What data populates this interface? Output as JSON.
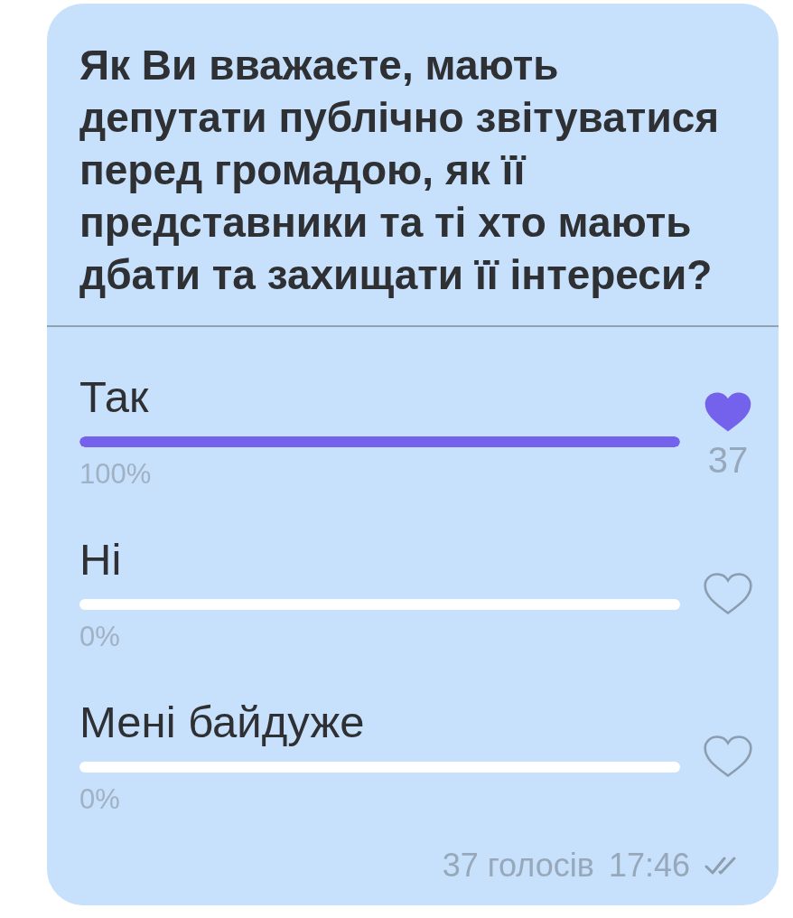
{
  "question": "Як Ви вважаєте, мають депутати публічно звітуватися перед громадою, як її представники та ті хто мають дбати та захищати її інтереси?",
  "options": [
    {
      "label": "Так",
      "level": 1,
      "percent": "100%",
      "selected": true,
      "count": "37"
    },
    {
      "label": "Ні",
      "level": 0,
      "percent": "0%",
      "selected": false
    },
    {
      "label": "Мені байдуже",
      "level": 0,
      "percent": "0%",
      "selected": false
    }
  ],
  "footer": {
    "votes": "37 голосів",
    "time": "17:46",
    "read": true
  }
}
